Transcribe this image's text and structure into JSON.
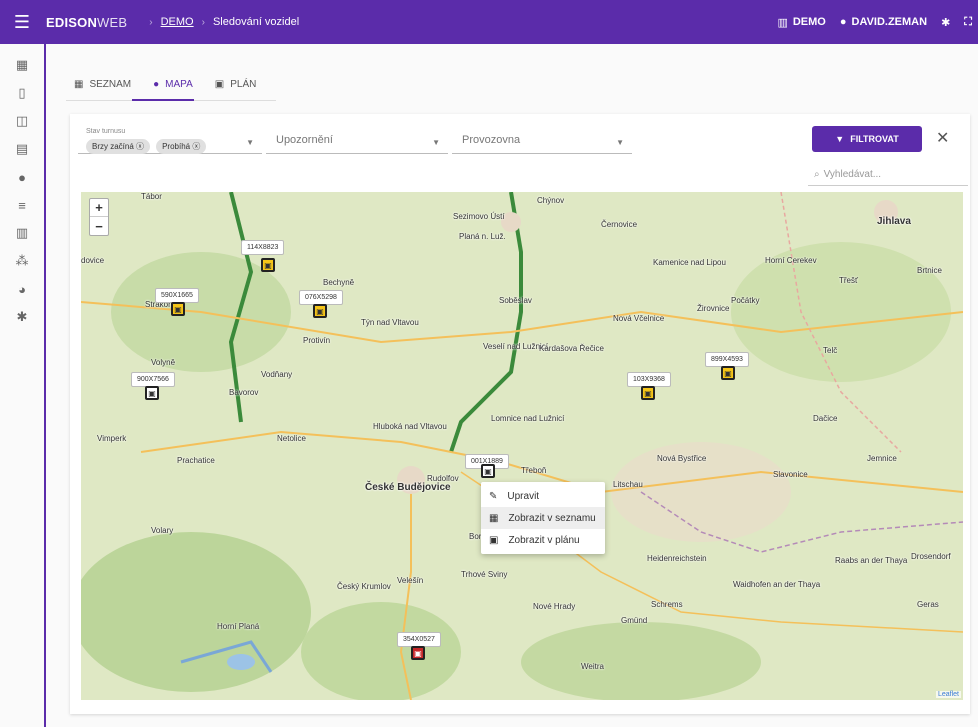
{
  "header": {
    "brand_bold": "EDISON",
    "brand_light": "WEB",
    "breadcrumb": [
      "DEMO",
      "Sledování vozidel"
    ],
    "org": "DEMO",
    "user": "DAVID.ZEMAN"
  },
  "sidebar": {
    "icons": [
      "dashboard-icon",
      "map-icon",
      "vehicle-icon",
      "table-icon",
      "location-icon",
      "list-icon",
      "building-icon",
      "people-icon",
      "vehicle-settings-icon",
      "settings-icon"
    ]
  },
  "tabs": [
    {
      "label": "SEZNAM",
      "icon": "table-icon"
    },
    {
      "label": "MAPA",
      "icon": "location-icon"
    },
    {
      "label": "PLÁN",
      "icon": "calendar-icon"
    }
  ],
  "filters": {
    "stav": {
      "label": "Stav turnusu",
      "chips": [
        "Brzy začíná",
        "Probíhá"
      ]
    },
    "upozorneni": {
      "placeholder": "Upozornění"
    },
    "provozovna": {
      "placeholder": "Provozovna"
    },
    "button": "FILTROVAT"
  },
  "search": {
    "placeholder": "Vyhledávat..."
  },
  "map": {
    "towns": [
      {
        "name": "Tábor"
      },
      {
        "name": "Chýnov"
      },
      {
        "name": "Jihlava",
        "big": true
      },
      {
        "name": "Sezimovo Ústí"
      },
      {
        "name": "Planá n. Luž."
      },
      {
        "name": "Černovice"
      },
      {
        "name": "Bechyně"
      },
      {
        "name": "Soběslav"
      },
      {
        "name": "Kamenice nad Lipou"
      },
      {
        "name": "Horní Cerekev"
      },
      {
        "name": "Třešť"
      },
      {
        "name": "Brtnice"
      },
      {
        "name": "Počátky"
      },
      {
        "name": "Žirovnice"
      },
      {
        "name": "Nová Včelnice"
      },
      {
        "name": "Týn nad Vltavou"
      },
      {
        "name": "Protivín"
      },
      {
        "name": "Veselí nad Lužnicí"
      },
      {
        "name": "Kardašova Řečice"
      },
      {
        "name": "Telč"
      },
      {
        "name": "Volyně"
      },
      {
        "name": "Vodňany"
      },
      {
        "name": "Bavorov"
      },
      {
        "name": "Lomnice nad Lužnicí"
      },
      {
        "name": "Dačice"
      },
      {
        "name": "Vimperk"
      },
      {
        "name": "Netolice"
      },
      {
        "name": "Hluboká nad Vltavou"
      },
      {
        "name": "Prachatice"
      },
      {
        "name": "Rudolfov"
      },
      {
        "name": "Třeboň"
      },
      {
        "name": "Nová Bystřice"
      },
      {
        "name": "Slavonice"
      },
      {
        "name": "Jemnice"
      },
      {
        "name": "České Budějovice",
        "big": true
      },
      {
        "name": "Litschau"
      },
      {
        "name": "Volary"
      },
      {
        "name": "Heidenreichstein"
      },
      {
        "name": "Raabs an der Thaya"
      },
      {
        "name": "Drosendorf"
      },
      {
        "name": "Trhové Sviny"
      },
      {
        "name": "Waidhofen an der Thaya"
      },
      {
        "name": "Český Krumlov"
      },
      {
        "name": "Velešín"
      },
      {
        "name": "Nové Hrady"
      },
      {
        "name": "Schrems"
      },
      {
        "name": "Gmünd"
      },
      {
        "name": "Geras"
      },
      {
        "name": "Horní Planá"
      },
      {
        "name": "Weitra"
      },
      {
        "name": "Strakonice"
      },
      {
        "name": "Bor"
      },
      {
        "name": "Vodňany"
      },
      {
        "name": "dovice"
      }
    ],
    "vehicles": [
      "114X8823",
      "590X1665",
      "076X5298",
      "900X7566",
      "899X4593",
      "103X9368",
      "001X1889",
      "354X0527"
    ],
    "attribution": "Leaflet"
  },
  "context_menu": [
    "Upravit",
    "Zobrazit v seznamu",
    "Zobrazit v plánu"
  ]
}
